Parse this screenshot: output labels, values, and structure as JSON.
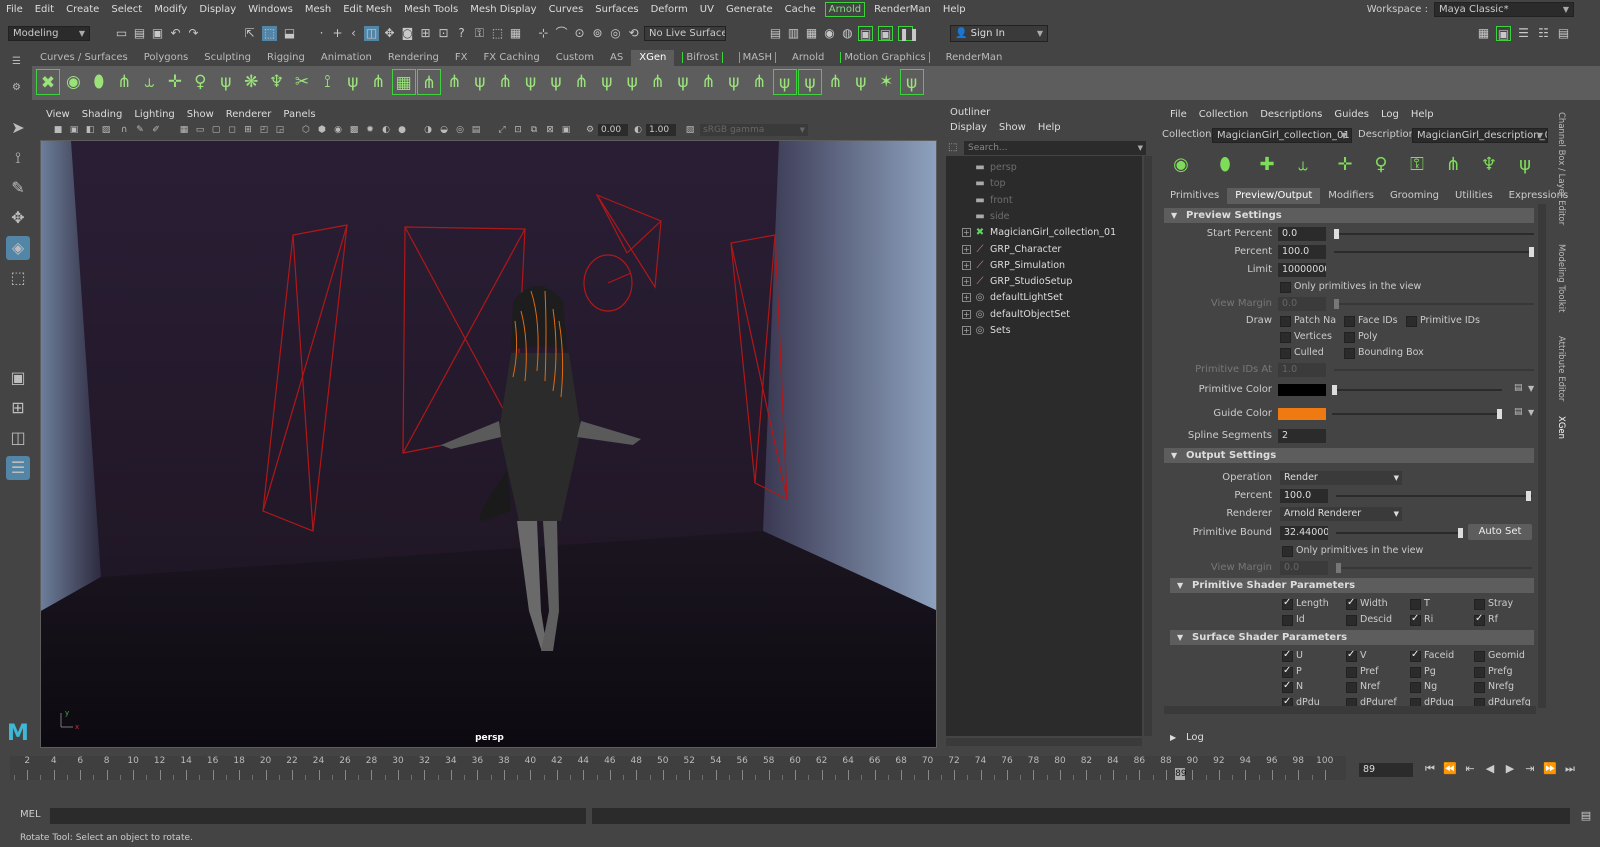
{
  "menubar": {
    "items": [
      "File",
      "Edit",
      "Create",
      "Select",
      "Modify",
      "Display",
      "Windows",
      "Mesh",
      "Edit Mesh",
      "Mesh Tools",
      "Mesh Display",
      "Curves",
      "Surfaces",
      "Deform",
      "UV",
      "Generate",
      "Cache",
      "Arnold",
      "RenderMan",
      "Help"
    ],
    "workspace_label": "Workspace :",
    "workspace_value": "Maya Classic*"
  },
  "statusline": {
    "mode": "Modeling",
    "live_surface": "No Live Surface",
    "sign_in": "Sign In"
  },
  "shelf": {
    "tabs": [
      "Curves / Surfaces",
      "Polygons",
      "Sculpting",
      "Rigging",
      "Animation",
      "Rendering",
      "FX",
      "FX Caching",
      "Custom",
      "AS",
      "XGen",
      "Bifrost",
      "MASH",
      "Arnold",
      "Motion Graphics",
      "RenderMan"
    ],
    "active_tab": "XGen"
  },
  "viewport": {
    "menu": [
      "View",
      "Shading",
      "Lighting",
      "Show",
      "Renderer",
      "Panels"
    ],
    "exposure": "0.00",
    "gamma": "1.00",
    "color_space": "sRGB gamma",
    "camera_label": "persp"
  },
  "outliner": {
    "title": "Outliner",
    "menu": [
      "Display",
      "Show",
      "Help"
    ],
    "search_placeholder": "Search...",
    "items": [
      {
        "label": "persp",
        "dim": true
      },
      {
        "label": "top",
        "dim": true
      },
      {
        "label": "front",
        "dim": true
      },
      {
        "label": "side",
        "dim": true
      },
      {
        "label": "MagicianGirl_collection_01",
        "dim": false
      },
      {
        "label": "GRP_Character",
        "dim": false
      },
      {
        "label": "GRP_Simulation",
        "dim": false
      },
      {
        "label": "GRP_StudioSetup",
        "dim": false
      },
      {
        "label": "defaultLightSet",
        "dim": false
      },
      {
        "label": "defaultObjectSet",
        "dim": false
      },
      {
        "label": "Sets",
        "dim": false
      }
    ]
  },
  "xgen": {
    "menu": [
      "File",
      "Collection",
      "Descriptions",
      "Guides",
      "Log",
      "Help"
    ],
    "collection_label": "Collection",
    "collection_value": "MagicianGirl_collection_01",
    "description_label": "Description",
    "description_value": "MagicianGirl_description_01",
    "tabs": [
      "Primitives",
      "Preview/Output",
      "Modifiers",
      "Grooming",
      "Utilities",
      "Expressions"
    ],
    "active_tab": "Preview/Output",
    "preview": {
      "title": "Preview Settings",
      "start_percent_label": "Start Percent",
      "start_percent": "0.0",
      "percent_label": "Percent",
      "percent": "100.0",
      "limit_label": "Limit",
      "limit": "100000000",
      "only_primitives": "Only primitives in the view",
      "view_margin_label": "View Margin",
      "view_margin": "0.0",
      "draw_label": "Draw",
      "draw": [
        "Patch Na",
        "Face IDs",
        "Primitive IDs",
        "Vertices",
        "Poly",
        "Culled",
        "Bounding Box"
      ],
      "primitive_ids_at_label": "Primitive IDs At",
      "primitive_ids_at": "1.0",
      "primitive_color_label": "Primitive Color",
      "primitive_color": "#000000",
      "guide_color_label": "Guide Color",
      "guide_color": "#f07a12",
      "spline_segments_label": "Spline Segments",
      "spline_segments": "2"
    },
    "output": {
      "title": "Output Settings",
      "operation_label": "Operation",
      "operation": "Render",
      "percent_label": "Percent",
      "percent": "100.0",
      "renderer_label": "Renderer",
      "renderer": "Arnold Renderer",
      "primitive_bound_label": "Primitive Bound",
      "primitive_bound": "32.440000",
      "auto_set": "Auto Set",
      "only_primitives": "Only primitives in the view",
      "view_margin_label": "View Margin",
      "view_margin": "0.0"
    },
    "prim_shader": {
      "title": "Primitive Shader Parameters",
      "params": [
        {
          "label": "Length",
          "on": true
        },
        {
          "label": "Width",
          "on": true
        },
        {
          "label": "T",
          "on": false
        },
        {
          "label": "Stray",
          "on": false
        },
        {
          "label": "Id",
          "on": false
        },
        {
          "label": "Descid",
          "on": false
        },
        {
          "label": "Ri",
          "on": true
        },
        {
          "label": "Rf",
          "on": true
        }
      ]
    },
    "surf_shader": {
      "title": "Surface Shader Parameters",
      "params": [
        {
          "label": "U",
          "on": true
        },
        {
          "label": "V",
          "on": true
        },
        {
          "label": "Faceid",
          "on": true
        },
        {
          "label": "Geomid",
          "on": false
        },
        {
          "label": "P",
          "on": true
        },
        {
          "label": "Pref",
          "on": false
        },
        {
          "label": "Pg",
          "on": false
        },
        {
          "label": "Prefg",
          "on": false
        },
        {
          "label": "N",
          "on": true
        },
        {
          "label": "Nref",
          "on": false
        },
        {
          "label": "Ng",
          "on": false
        },
        {
          "label": "Nrefg",
          "on": false
        },
        {
          "label": "dPdu",
          "on": true
        },
        {
          "label": "dPduref",
          "on": false
        },
        {
          "label": "dPdug",
          "on": false
        },
        {
          "label": "dPdurefg",
          "on": false
        }
      ]
    },
    "log_title": "Log"
  },
  "side_tabs": [
    "Channel Box / Layer Editor",
    "Modeling Toolkit",
    "Attribute Editor",
    "XGen"
  ],
  "timeline": {
    "ticks": [
      "2",
      "4",
      "6",
      "8",
      "10",
      "12",
      "14",
      "16",
      "18",
      "20",
      "22",
      "24",
      "26",
      "28",
      "30",
      "32",
      "34",
      "36",
      "38",
      "40",
      "42",
      "44",
      "46",
      "48",
      "50",
      "52",
      "54",
      "56",
      "58",
      "60",
      "62",
      "64",
      "66",
      "68",
      "70",
      "72",
      "74",
      "76",
      "78",
      "80",
      "82",
      "84",
      "86",
      "88",
      "90",
      "92",
      "94",
      "96",
      "98",
      "100"
    ],
    "current_frame": "89",
    "frame_field": "89"
  },
  "cmdline": {
    "label": "MEL"
  },
  "helpline": {
    "text": "Rotate Tool: Select an object to rotate."
  }
}
